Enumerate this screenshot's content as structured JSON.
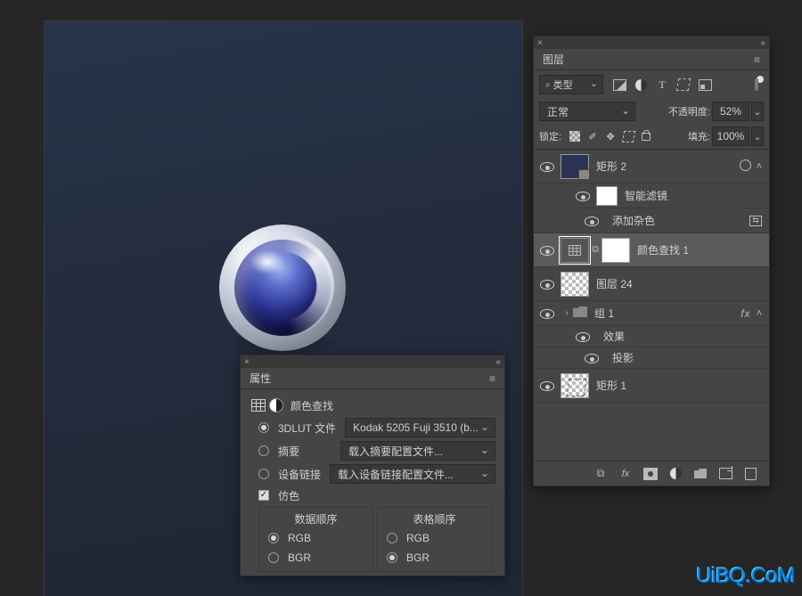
{
  "properties_panel": {
    "title": "属性",
    "adjustment_name": "颜色查找",
    "row_3dlut": {
      "label": "3DLUT 文件",
      "value": "Kodak 5205 Fuji 3510 (b..."
    },
    "row_abstract": {
      "label": "摘要",
      "value": "载入摘要配置文件..."
    },
    "row_device": {
      "label": "设备链接",
      "value": "载入设备链接配置文件..."
    },
    "dither_label": "仿色",
    "data_order": {
      "title": "数据顺序",
      "rgb": "RGB",
      "bgr": "BGR"
    },
    "table_order": {
      "title": "表格顺序",
      "rgb": "RGB",
      "bgr": "BGR"
    }
  },
  "layers_panel": {
    "title": "图层",
    "type_filter": "类型",
    "blend_mode": "正常",
    "opacity": {
      "label": "不透明度:",
      "value": "52%"
    },
    "lock_label": "锁定:",
    "fill": {
      "label": "填充:",
      "value": "100%"
    },
    "layers": {
      "rect2": "矩形 2",
      "smart_filter": "智能滤镜",
      "add_noise": "添加杂色",
      "color_lookup": "颜色查找 1",
      "layer24": "图层 24",
      "group1": "组 1",
      "effects": "效果",
      "drop_shadow": "投影",
      "rect1": "矩形 1"
    },
    "fx": "fx"
  },
  "watermark": "UiBQ.CoM"
}
